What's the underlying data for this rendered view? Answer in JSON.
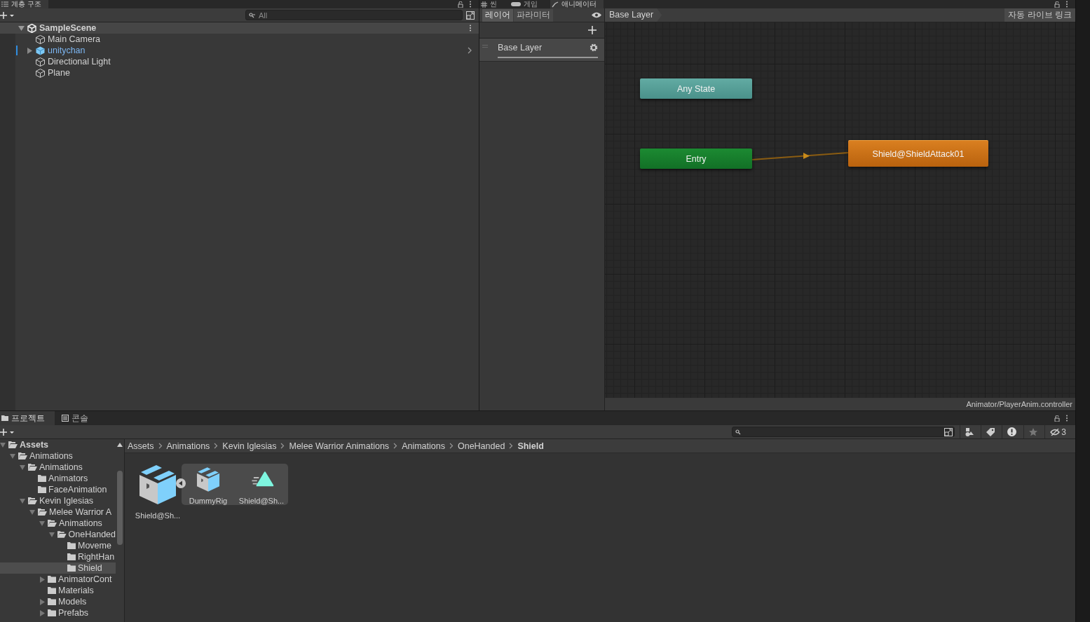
{
  "hierarchy": {
    "tab": "계층 구조",
    "search": {
      "placeholder": "All"
    },
    "scene": "SampleScene",
    "items": [
      {
        "name": "Main Camera",
        "kind": "object",
        "selected": false
      },
      {
        "name": "unitychan",
        "kind": "prefab",
        "expanded": false,
        "selected": false
      },
      {
        "name": "Directional Light",
        "kind": "object",
        "selected": false
      },
      {
        "name": "Plane",
        "kind": "object",
        "selected": false
      }
    ]
  },
  "animator_tabs": [
    {
      "label": "씬",
      "kind": "scene",
      "selected": false
    },
    {
      "label": "게임",
      "kind": "game",
      "selected": false
    },
    {
      "label": "애니메이터",
      "kind": "animator",
      "selected": true
    }
  ],
  "animator": {
    "side_tabs": [
      {
        "label": "레이어",
        "selected": true
      },
      {
        "label": "파라미터",
        "selected": false
      }
    ],
    "layers": [
      {
        "name": "Base Layer"
      }
    ],
    "breadcrumb": "Base Layer",
    "live_link": "자동 라이브 링크",
    "states": [
      {
        "name": "Any State",
        "kind": "any"
      },
      {
        "name": "Entry",
        "kind": "entry"
      },
      {
        "name": "Shield@ShieldAttack01",
        "kind": "default"
      }
    ],
    "footer": "Animator/PlayerAnim.controller"
  },
  "project": {
    "tabs": [
      {
        "label": "프로젝트",
        "kind": "project",
        "selected": true
      },
      {
        "label": "콘솔",
        "kind": "console",
        "selected": false
      }
    ],
    "hidden_count": "3",
    "tree": [
      {
        "name": "Assets",
        "expanded": true,
        "selected": false,
        "children": [
          {
            "name": "Animations",
            "expanded": true,
            "selected": false,
            "children": [
              {
                "name": "Animations",
                "expanded": true,
                "selected": false,
                "children": [
                  {
                    "name": "Animators",
                    "selected": false
                  },
                  {
                    "name": "FaceAnimation",
                    "selected": false
                  }
                ]
              },
              {
                "name": "Kevin Iglesias",
                "expanded": true,
                "selected": false,
                "children": [
                  {
                    "name": "Melee Warrior A",
                    "expanded": true,
                    "selected": false,
                    "children": [
                      {
                        "name": "Animations",
                        "expanded": true,
                        "selected": false,
                        "children": [
                          {
                            "name": "OneHanded",
                            "expanded": true,
                            "selected": false,
                            "children": [
                              {
                                "name": "Moveme",
                                "selected": false
                              },
                              {
                                "name": "RightHan",
                                "selected": false
                              },
                              {
                                "name": "Shield",
                                "selected": true
                              }
                            ]
                          }
                        ]
                      },
                      {
                        "name": "AnimatorCont",
                        "expanded": false,
                        "selected": false
                      },
                      {
                        "name": "Materials",
                        "selected": false
                      },
                      {
                        "name": "Models",
                        "expanded": false,
                        "selected": false
                      },
                      {
                        "name": "Prefabs",
                        "expanded": false,
                        "selected": false
                      }
                    ]
                  }
                ]
              }
            ]
          }
        ]
      }
    ],
    "breadcrumb": [
      "Assets",
      "Animations",
      "Kevin Iglesias",
      "Melee Warrior Animations",
      "Animations",
      "OneHanded",
      "Shield"
    ],
    "assets": [
      {
        "name": "Shield@Sh...",
        "kind": "model",
        "expanded": true,
        "children": [
          {
            "name": "DummyRig",
            "kind": "model"
          },
          {
            "name": "Shield@Sh...",
            "kind": "clip"
          }
        ]
      }
    ]
  }
}
